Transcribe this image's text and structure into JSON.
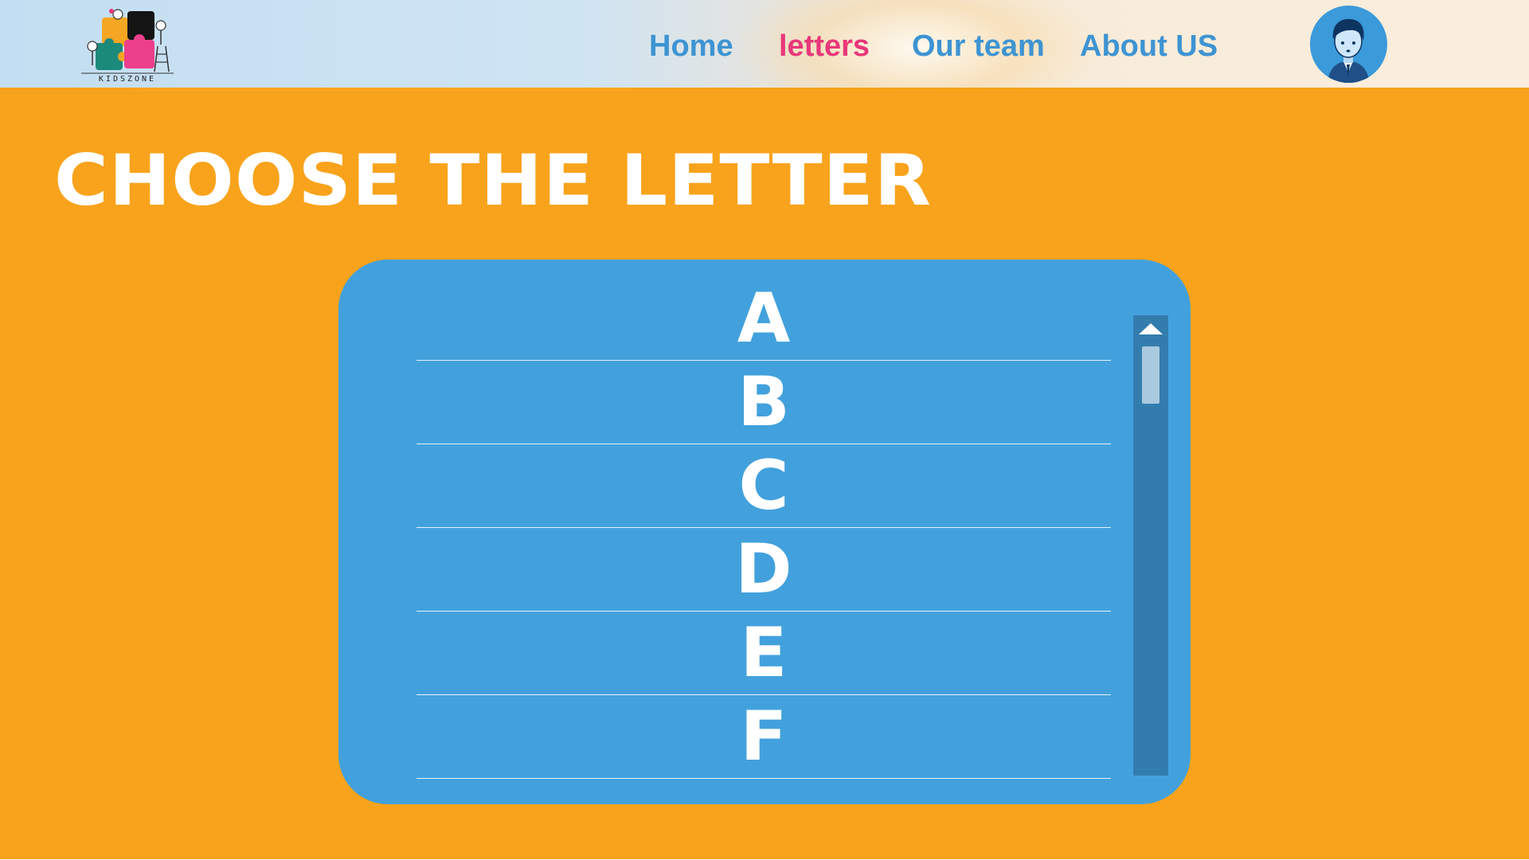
{
  "header": {
    "logo_text": "KIDSZONE",
    "nav": [
      {
        "label": "Home",
        "active": false
      },
      {
        "label": "letters",
        "active": true
      },
      {
        "label": "Our team",
        "active": false
      },
      {
        "label": "About US",
        "active": false
      }
    ],
    "avatar_icon": "boy-avatar-icon"
  },
  "main": {
    "title": "CHOOSE THE LETTER",
    "letters": [
      "A",
      "B",
      "C",
      "D",
      "E",
      "F"
    ]
  },
  "colors": {
    "header_nav": "#3e94d2",
    "header_nav_active": "#e8387a",
    "main_background": "#f9a31c",
    "panel": "#42a1dd",
    "scrollbar_track": "#337dae",
    "scrollbar_thumb": "#a9c9de",
    "text_on_color": "#ffffff"
  }
}
